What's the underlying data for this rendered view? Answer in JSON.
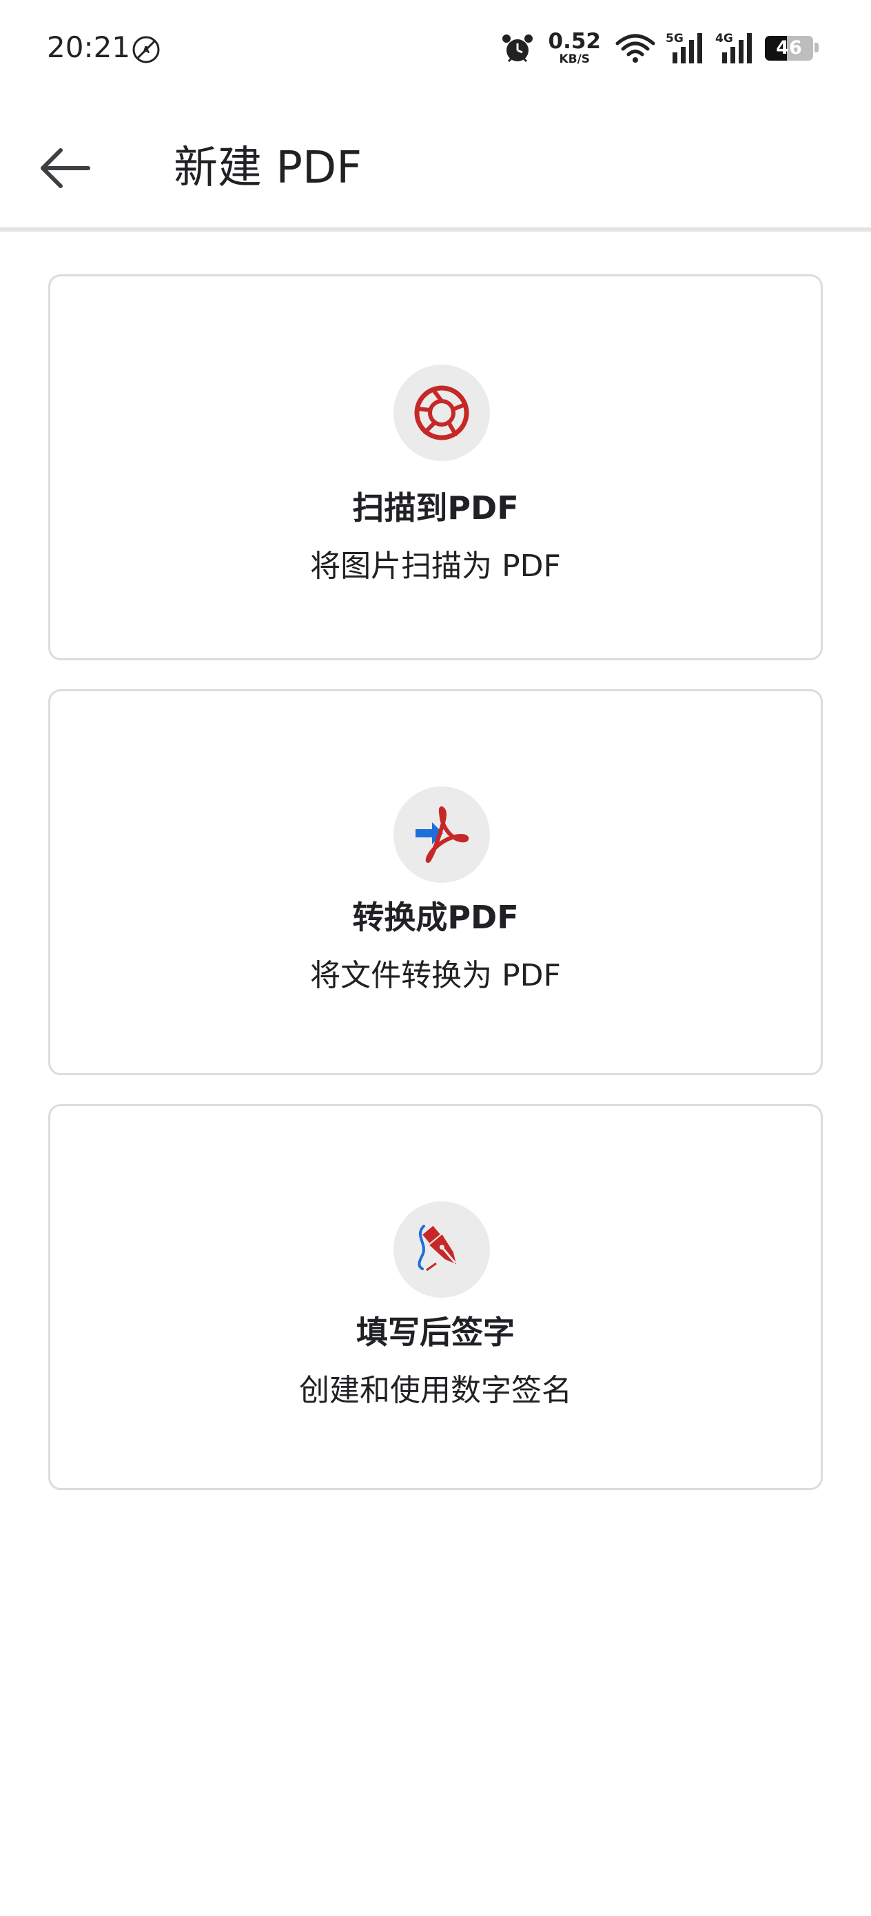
{
  "status_bar": {
    "time": "20:21",
    "net_speed_value": "0.52",
    "net_speed_unit": "KB/S",
    "signal_1_label": "5G",
    "signal_2_label": "4G",
    "battery_level": "46",
    "battery_fraction": 0.46,
    "icons": [
      "no-disturb-icon",
      "alarm-icon",
      "wifi-icon",
      "cell-signal-icon",
      "battery-icon"
    ]
  },
  "app_bar": {
    "title": "新建 PDF"
  },
  "cards": [
    {
      "title": "扫描到PDF",
      "subtitle": "将图片扫描为 PDF",
      "icon": "camera-shutter-icon"
    },
    {
      "title": "转换成PDF",
      "subtitle": "将文件转换为 PDF",
      "icon": "convert-to-pdf-icon"
    },
    {
      "title": "填写后签字",
      "subtitle": "创建和使用数字签名",
      "icon": "pen-signature-icon"
    }
  ],
  "colors": {
    "accent_red": "#c62828",
    "accent_blue": "#1e6fd9",
    "icon_circle_bg": "#ebebeb",
    "card_border": "#dcdcdc",
    "divider": "#e3e3e3"
  }
}
